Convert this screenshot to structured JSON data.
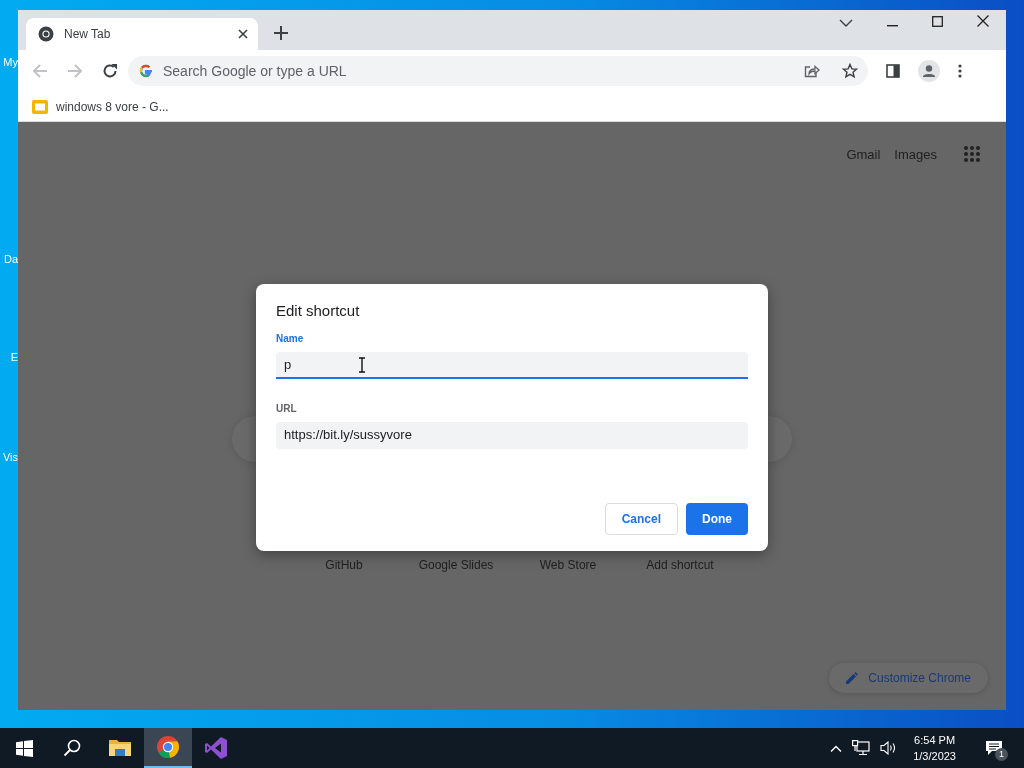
{
  "desktop_icons": [
    {
      "label": "My"
    },
    {
      "label": "Da"
    },
    {
      "label": "E"
    },
    {
      "label": "Vis"
    }
  ],
  "browser": {
    "tabs": [
      {
        "title": "New Tab",
        "selected": true
      }
    ],
    "omnibox": {
      "placeholder": "Search Google or type a URL"
    },
    "bookmarks": [
      {
        "label": "windows 8 vore - G..."
      }
    ]
  },
  "new_tab_page": {
    "header_links": [
      "Gmail",
      "Images"
    ],
    "shortcuts": [
      {
        "label": "GitHub"
      },
      {
        "label": "Google Slides"
      },
      {
        "label": "Web Store"
      },
      {
        "label": "Add shortcut"
      }
    ],
    "customize_button": "Customize Chrome"
  },
  "dialog": {
    "title": "Edit shortcut",
    "fields": [
      {
        "label": "Name",
        "value": "p",
        "focused": true
      },
      {
        "label": "URL",
        "value": "https://bit.ly/sussyvore",
        "focused": false
      }
    ],
    "buttons": [
      {
        "label": "Cancel",
        "kind": "secondary"
      },
      {
        "label": "Done",
        "kind": "primary"
      }
    ]
  },
  "taskbar": {
    "apps": [
      {
        "kind": "explorer",
        "active": false
      },
      {
        "kind": "chrome",
        "active": true
      },
      {
        "kind": "studio",
        "active": false
      }
    ],
    "clock": {
      "time": "6:54 PM",
      "date": "1/3/2023"
    },
    "notification_count": "1"
  }
}
